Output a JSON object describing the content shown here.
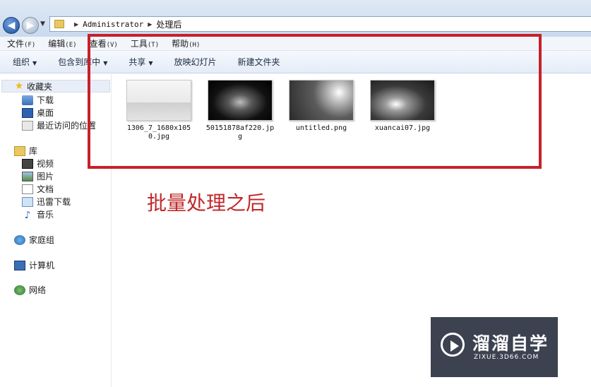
{
  "address_bar": {
    "breadcrumbs": [
      "Administrator",
      "处理后"
    ]
  },
  "menu_bar": {
    "items": [
      {
        "label": "文件",
        "accel": "(F)"
      },
      {
        "label": "编辑",
        "accel": "(E)"
      },
      {
        "label": "查看",
        "accel": "(V)"
      },
      {
        "label": "工具",
        "accel": "(T)"
      },
      {
        "label": "帮助",
        "accel": "(H)"
      }
    ]
  },
  "command_bar": {
    "organize": "组织",
    "include_in_library": "包含到库中",
    "share": "共享",
    "slideshow": "放映幻灯片",
    "new_folder": "新建文件夹"
  },
  "nav_pane": {
    "favorites": {
      "label": "收藏夹",
      "items": [
        "下载",
        "桌面",
        "最近访问的位置"
      ]
    },
    "libraries": {
      "label": "库",
      "items": [
        "视频",
        "图片",
        "文档",
        "迅雷下载",
        "音乐"
      ]
    },
    "homegroup": "家庭组",
    "computer": "计算机",
    "network": "网络"
  },
  "files": [
    {
      "name": "1306_7_1680x1050.jpg"
    },
    {
      "name": "50151878af220.jpg"
    },
    {
      "name": "untitled.png"
    },
    {
      "name": "xuancai07.jpg"
    }
  ],
  "annotation": {
    "text": "批量处理之后",
    "color": "#c0282a"
  },
  "watermark": {
    "brand": "溜溜自学",
    "url": "ZIXUE.3D66.COM",
    "background": "#3c4250"
  }
}
